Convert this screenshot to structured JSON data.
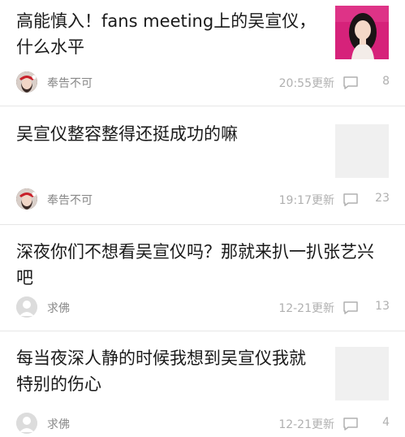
{
  "posts": [
    {
      "title": "高能慎入！fans meeting上的吴宣仪，什么水平",
      "author": "奉告不可",
      "time": "20:55更新",
      "comments": "8"
    },
    {
      "title": "吴宣仪整容整得还挺成功的嘛",
      "author": "奉告不可",
      "time": "19:17更新",
      "comments": "23"
    },
    {
      "title": "深夜你们不想看吴宣仪吗？那就来扒一扒张艺兴吧",
      "author": "求佛",
      "time": "12-21更新",
      "comments": "13"
    },
    {
      "title": "每当夜深人静的时候我想到吴宣仪我就特别的伤心",
      "author": "求佛",
      "time": "12-21更新",
      "comments": "4"
    }
  ],
  "colors": {
    "title": "#1a1a1a",
    "meta": "#b0b0b0",
    "author": "#888888",
    "divider": "#e6e6e6",
    "thumb_placeholder": "#f0f0f0",
    "photo_bg": "#d6227a"
  },
  "icons": {
    "comment": "comment-bubble-icon",
    "avatar_default": "default-user-icon"
  }
}
